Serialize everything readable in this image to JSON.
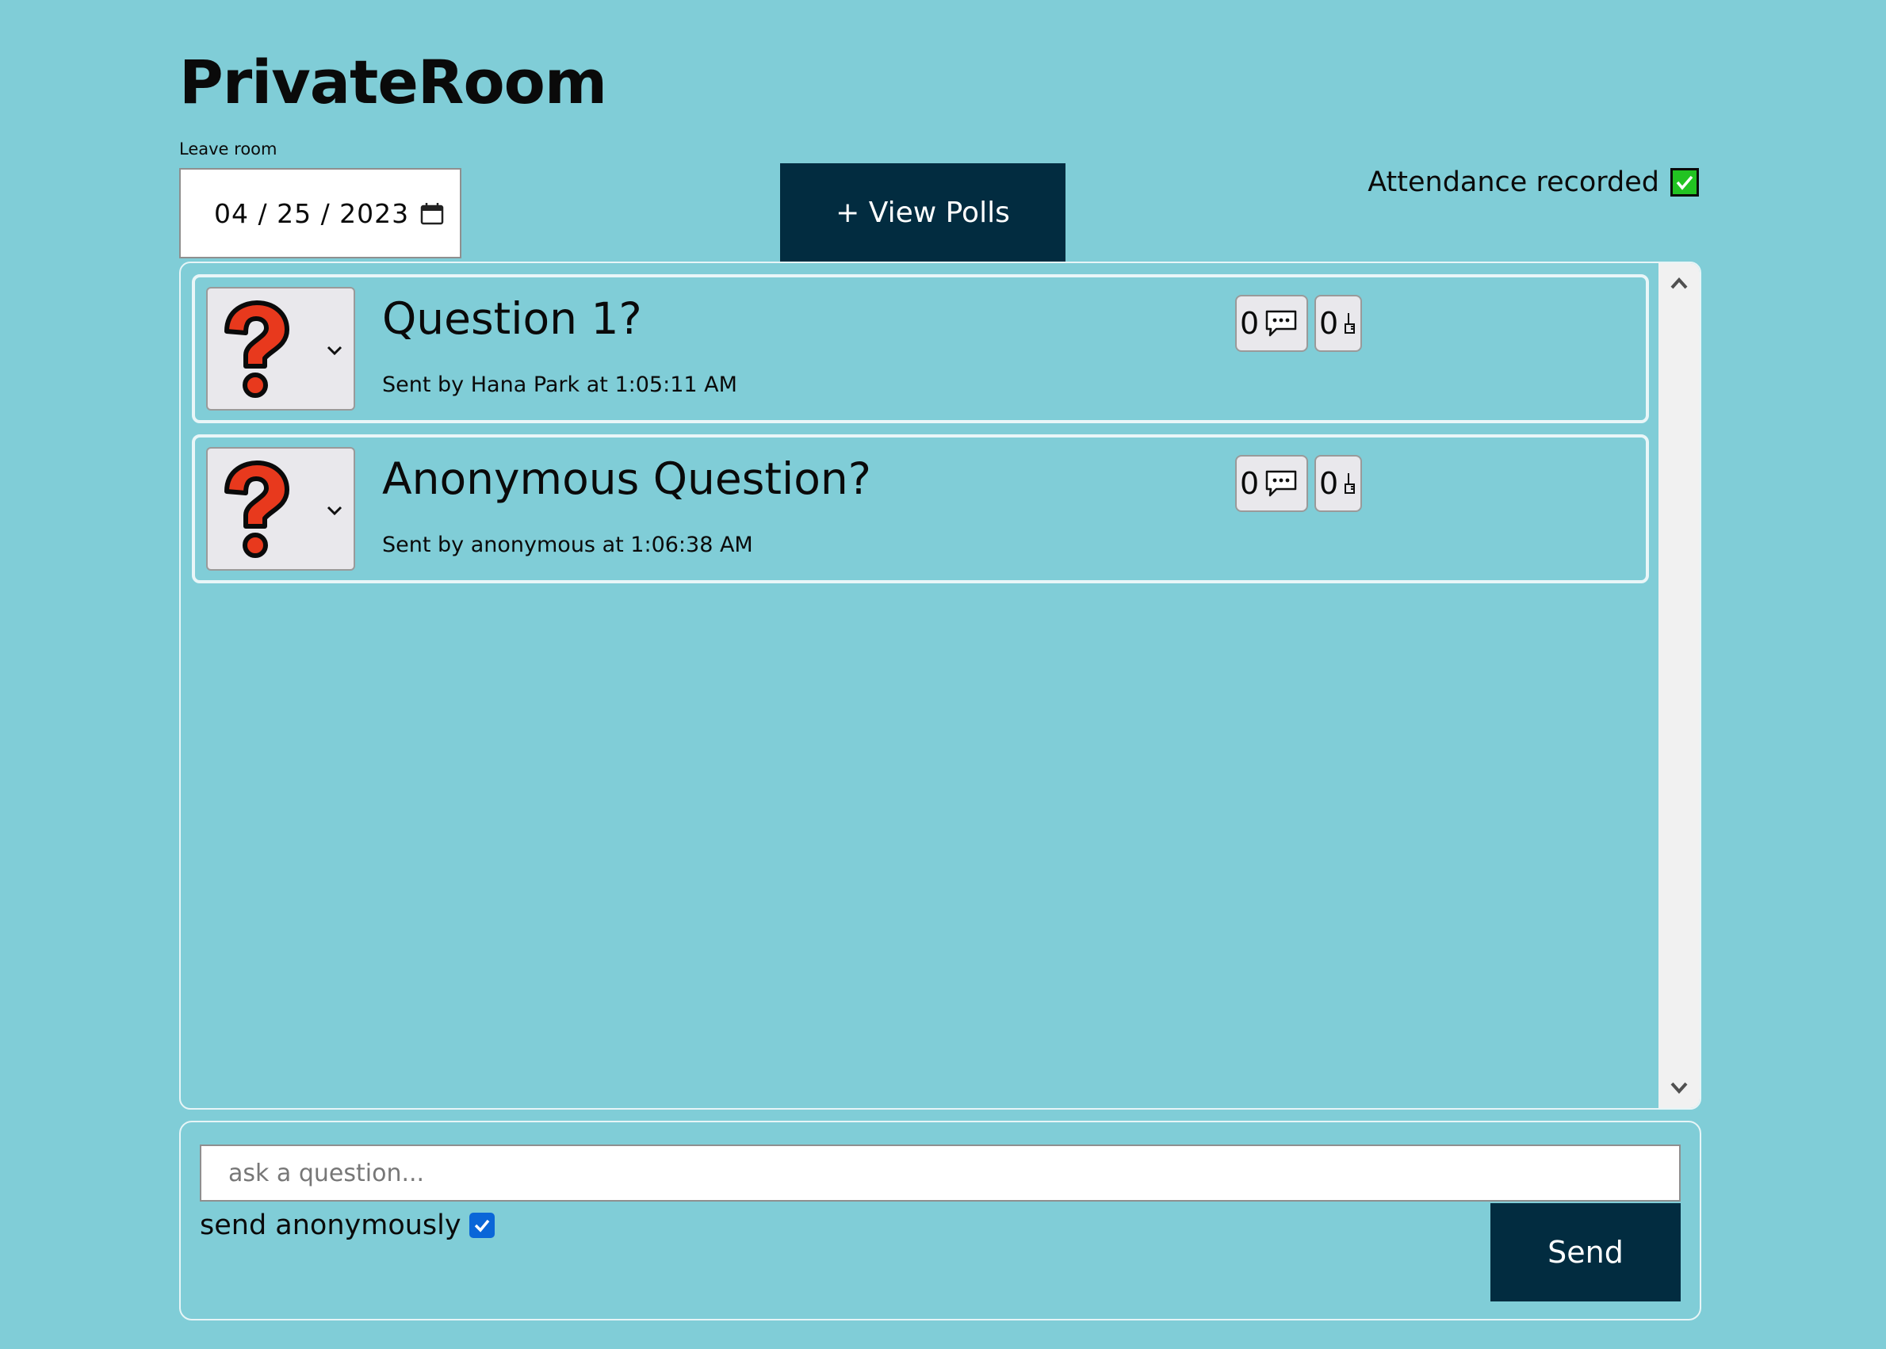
{
  "room": {
    "title": "PrivateRoom",
    "leave_label": "Leave room"
  },
  "date": {
    "value": "04 / 25 / 2023",
    "icon": "calendar-icon"
  },
  "toolbar": {
    "view_polls_label": "+ View Polls"
  },
  "attendance": {
    "label": "Attendance recorded",
    "checked": true,
    "color": "#22c322"
  },
  "questions": [
    {
      "title": "Question 1?",
      "meta": "Sent by Hana Park at 1:05:11 AM",
      "replies": "0",
      "upvotes": "0",
      "icon": "question-mark-icon"
    },
    {
      "title": "Anonymous Question?",
      "meta": "Sent by anonymous at 1:06:38 AM",
      "replies": "0",
      "upvotes": "0",
      "icon": "question-mark-icon"
    }
  ],
  "compose": {
    "placeholder": "ask a question...",
    "anonymous_label": "send anonymously",
    "anonymous_checked": true,
    "send_label": "Send"
  },
  "colors": {
    "background": "#80cdd7",
    "button": "#022c40",
    "question_mark": "#e8391d",
    "checkbox_blue": "#0a66d8"
  }
}
